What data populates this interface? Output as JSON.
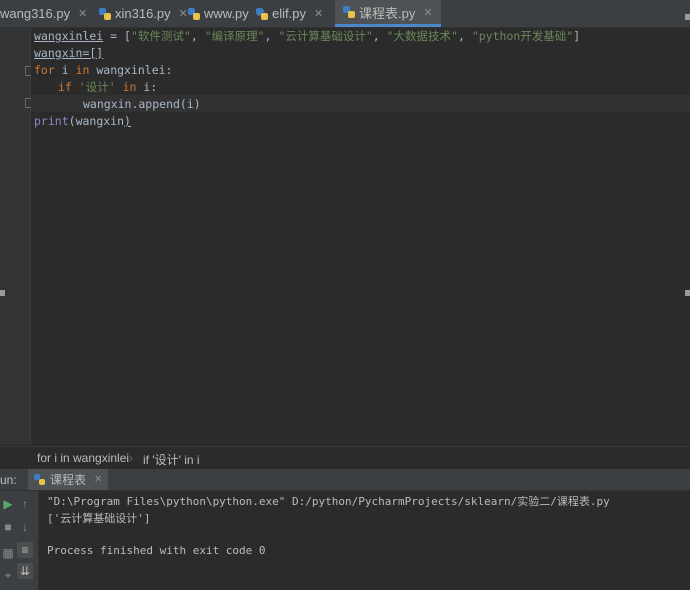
{
  "tabs": [
    {
      "label": "wang316.py"
    },
    {
      "label": "xin316.py"
    },
    {
      "label": "www.py"
    },
    {
      "label": "elif.py"
    },
    {
      "label": "课程表.py"
    }
  ],
  "code": {
    "line1": {
      "var": "wangxinlei",
      "op": " = [",
      "s1": "\"软件测试\"",
      "c1": ", ",
      "s2": "\"编译原理\"",
      "c2": ", ",
      "s3": "\"云计算基础设计\"",
      "c3": ", ",
      "s4": "\"大数据技术\"",
      "c4": ", ",
      "s5": "\"python开发基础\"",
      "end": "]"
    },
    "line2": {
      "text": "wangxin=[]"
    },
    "line3": {
      "kw1": "for",
      "t1": " i ",
      "kw2": "in",
      "t2": " wangxinlei:"
    },
    "line4": {
      "kw1": "if",
      "s": " '设计' ",
      "kw2": "in",
      "t": " i:"
    },
    "line5": {
      "text": "wangxin.append(i)"
    },
    "line6": {
      "fn": "print",
      "open": "(",
      "arg": "wangxin",
      "close": ")"
    }
  },
  "breadcrumb": {
    "item1": "for i in wangxinlei",
    "item2": "if '设计' in i"
  },
  "run": {
    "label": "un:",
    "tab": "课程表"
  },
  "console": {
    "cmd": "\"D:\\Program Files\\python\\python.exe\" D:/python/PycharmProjects/sklearn/实验二/课程表.py",
    "output": "['云计算基础设计']",
    "exit": "Process finished with exit code 0"
  },
  "colors": {
    "keyword": "#cc7832",
    "string": "#6a8759",
    "builtin": "#8888c6",
    "accent": "#4a88c7",
    "run_green": "#59a869"
  }
}
